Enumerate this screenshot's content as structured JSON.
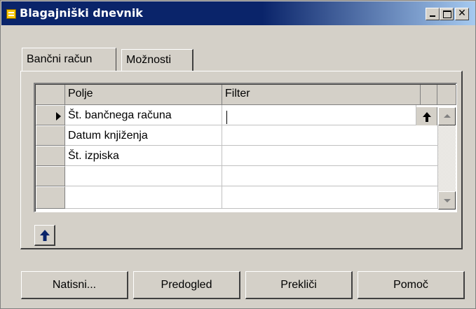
{
  "window": {
    "title": "Blagajniški dnevnik",
    "controls": {
      "minimize": "_",
      "maximize": "□",
      "close": "✕"
    }
  },
  "tabs": [
    {
      "label": "Bančni račun",
      "active": true
    },
    {
      "label": "Možnosti",
      "active": false
    }
  ],
  "grid": {
    "columns": [
      "Polje",
      "Filter"
    ],
    "rows": [
      {
        "field": "Št. bančnega računa",
        "filter": "",
        "current": true
      },
      {
        "field": "Datum knjiženja",
        "filter": ""
      },
      {
        "field": "Št. izpiska",
        "filter": ""
      },
      {
        "field": "",
        "filter": ""
      },
      {
        "field": "",
        "filter": ""
      }
    ]
  },
  "buttons": {
    "print": "Natisni...",
    "preview": "Predogled",
    "cancel": "Prekliči",
    "help": "Pomoč"
  },
  "colors": {
    "titlebar": "#0a246a",
    "face": "#d4d0c8",
    "app_icon": "#f5c400",
    "arrow_icon": "#0a246a"
  }
}
